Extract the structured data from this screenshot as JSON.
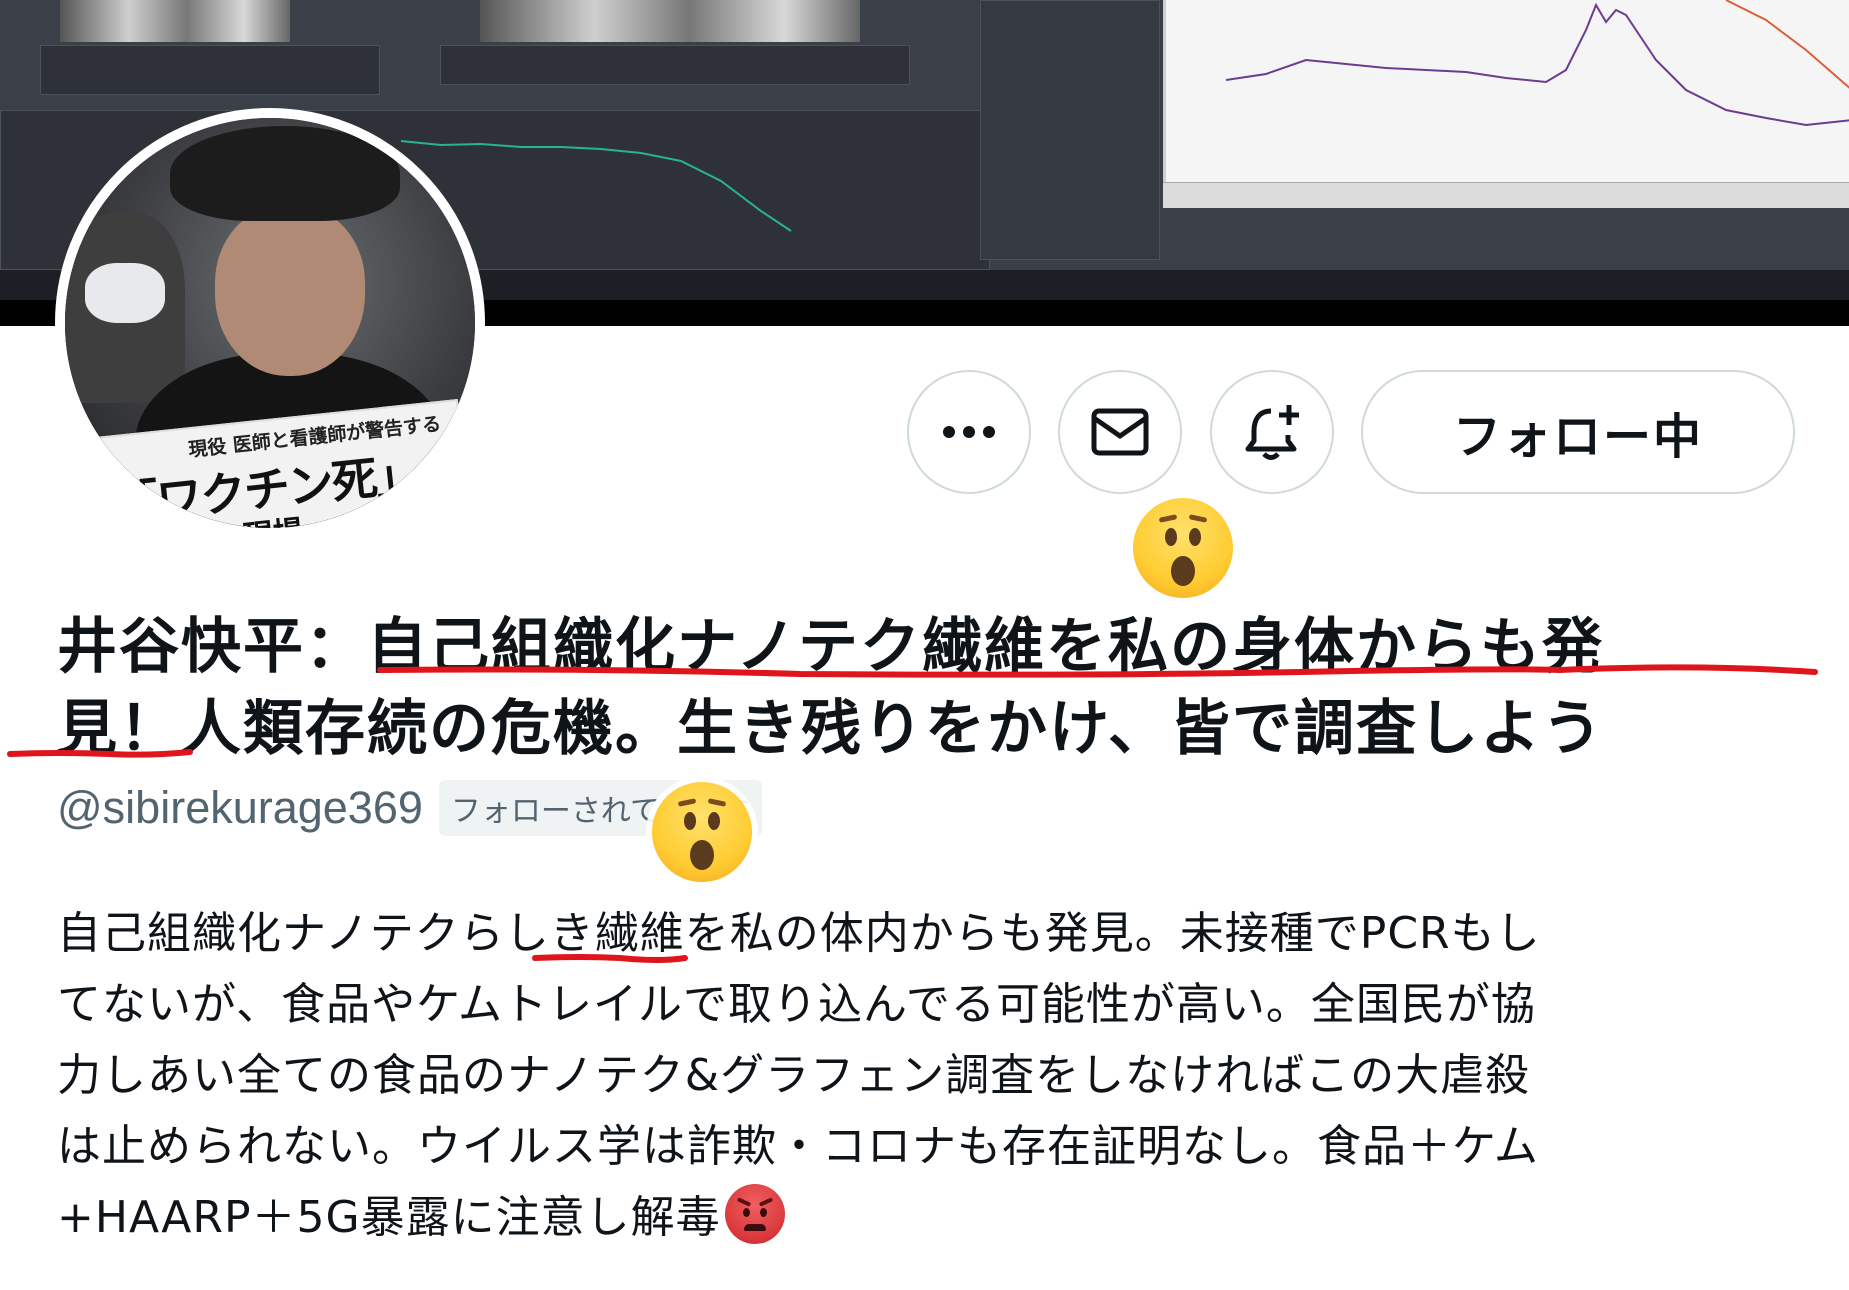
{
  "profile": {
    "display_name_line1": "井谷快平：自己組織化ナノテク繊維を私の身体からも発",
    "display_name_line2": "見！人類存続の危機。生き残りをかけ、皆で調査しよう",
    "handle": "@sibirekurage369",
    "follows_you_label": "フォローされています",
    "bio_lines": [
      "自己組織化ナノテクらしき繊維を私の体内からも発見。未接種でPCRもし",
      "てないが、食品やケムトレイルで取り込んでる可能性が高い。全国民が協",
      "力しあい全ての食品のナノテク&グラフェン調査をしなければこの大虐殺",
      "は止められない。ウイルス学は詐欺・コロナも存在証明なし。食品＋ケム",
      "+HAARP＋5G暴露に注意し解毒"
    ]
  },
  "actions": {
    "more_icon": "more-dots-icon",
    "message_icon": "envelope-icon",
    "notify_icon": "bell-plus-icon",
    "follow_label": "フォロー中"
  },
  "avatar": {
    "sign_subtitle": "現役 医師と看護師が警告する",
    "sign_title": "「ワクチン死」の",
    "sign_line3": "凄絶 な現場"
  },
  "overlays": {
    "emoji_1": "astonished-face-emoji",
    "emoji_2": "astonished-face-emoji",
    "bio_end_emoji": "angry-face-emoji",
    "annotation_color": "#e0141b"
  },
  "colors": {
    "text_primary": "#0f1419",
    "text_secondary": "#536471",
    "button_border": "#cfd9de",
    "badge_bg": "#eff3f4"
  }
}
